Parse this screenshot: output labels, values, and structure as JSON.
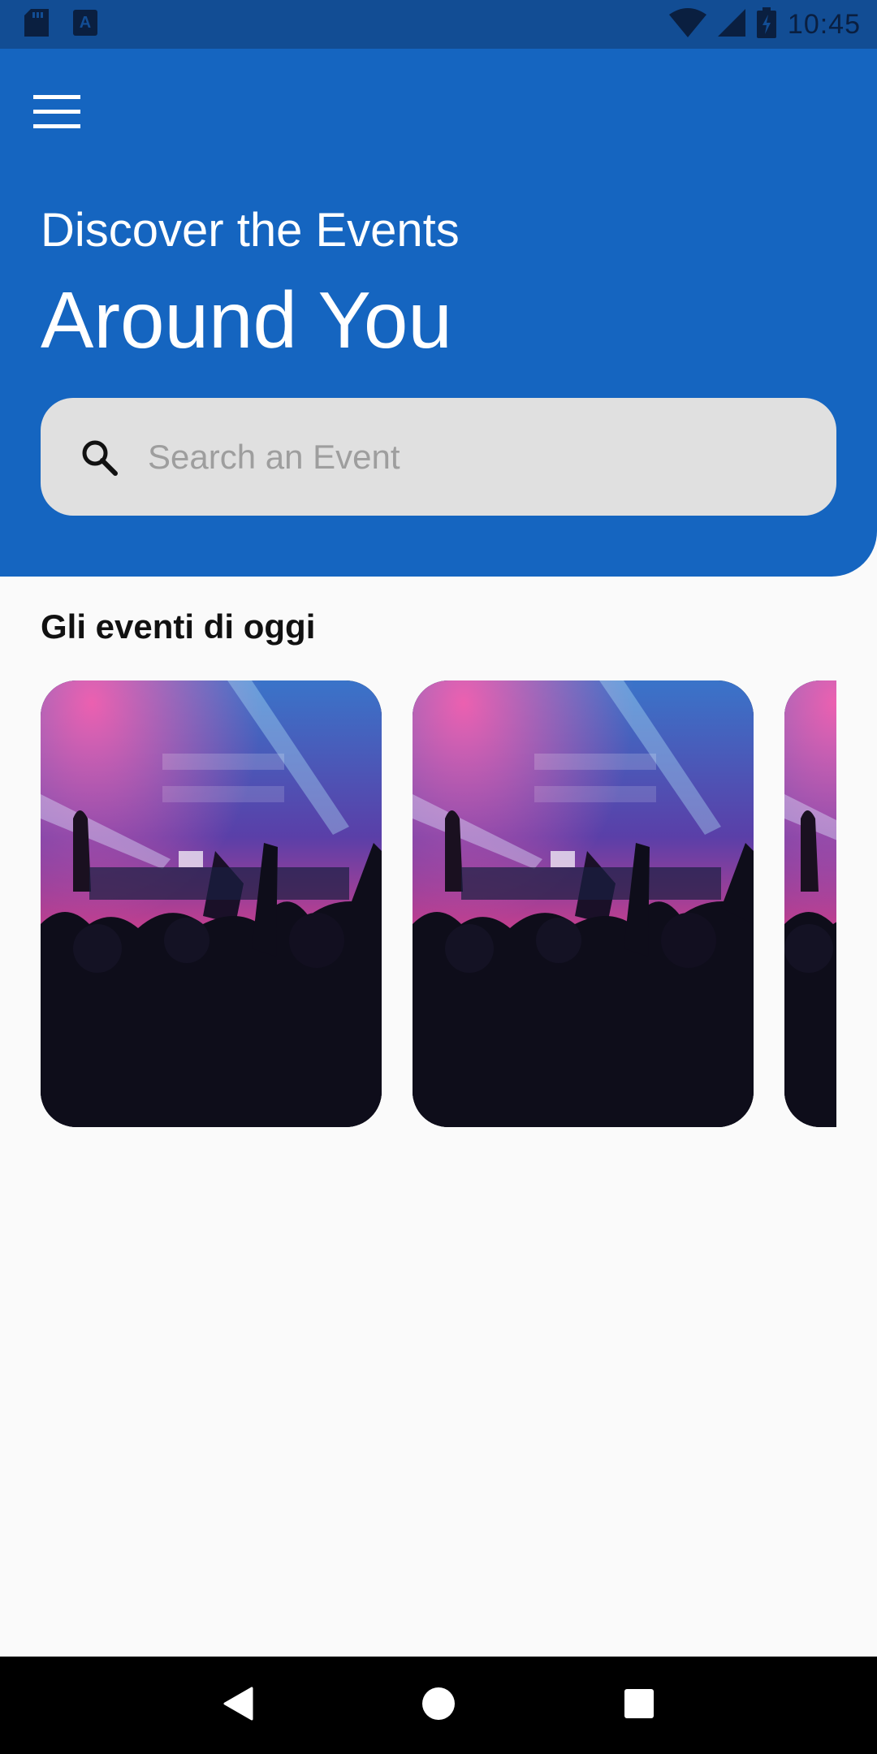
{
  "status_bar": {
    "time": "10:45",
    "icons": [
      "sd-card-icon",
      "keyboard-a-icon",
      "wifi-icon",
      "signal-icon",
      "battery-charging-icon"
    ]
  },
  "header": {
    "menu_icon": "hamburger-menu-icon",
    "subtitle": "Discover the Events",
    "title": "Around You",
    "background_color": "#1565c0"
  },
  "search": {
    "icon": "search-icon",
    "placeholder": "Search an Event",
    "value": ""
  },
  "section": {
    "title": "Gli eventi di oggi"
  },
  "events": [
    {
      "image": "concert-crowd-photo"
    },
    {
      "image": "concert-crowd-photo"
    },
    {
      "image": "concert-crowd-photo"
    }
  ],
  "nav_bar": {
    "back_icon": "back-triangle-icon",
    "home_icon": "home-circle-icon",
    "recents_icon": "recents-square-icon"
  }
}
